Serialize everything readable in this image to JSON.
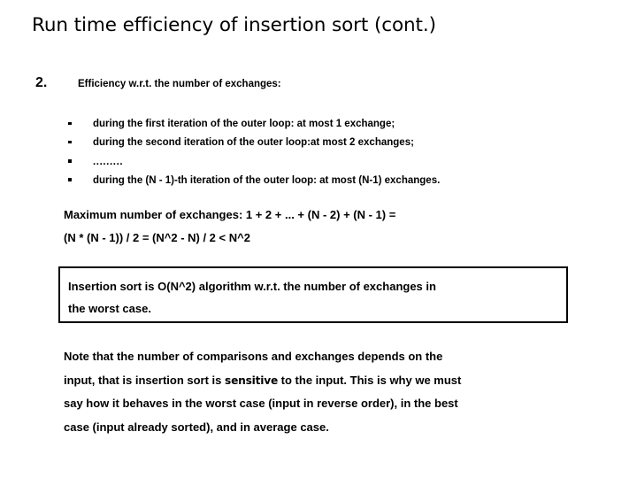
{
  "slide": {
    "title": "Run time efficiency of insertion sort (cont.)",
    "numbered_item": {
      "marker": "2.",
      "text": "Efficiency  w.r.t. the number of exchanges:"
    },
    "bullets": [
      {
        "marker": "square-bullet",
        "text": "during the first iteration of the outer loop: at most 1 exchange;"
      },
      {
        "marker": "square-bullet",
        "text": "during the second iteration of the outer loop:at most 2 exchanges;"
      },
      {
        "marker": "square-bullet",
        "text": "........."
      },
      {
        "marker": "square-bullet",
        "text": "during the (N - 1)-th iteration of the outer loop: at most (N-1) exchanges."
      }
    ],
    "formula": {
      "line1": "Maximum number of exchanges: 1 + 2 + ... + (N - 2) + (N - 1) =",
      "line2": "(N * (N - 1)) / 2 = (N^2 - N) / 2 < N^2"
    },
    "callout": {
      "line1": "Insertion sort is O(N^2) algorithm w.r.t. the number of  exchanges in",
      "line2": "the worst case.",
      "border_color": "#000000"
    },
    "note": {
      "line1": "Note that the number of comparisons and exchanges depends on the",
      "line2_part1": "input, that is insertion sort is ",
      "line2_emphasis": "sensitive",
      "line2_part2": " to the input. This is why we must",
      "line3": "say how it behaves in the worst case (input in reverse order), in the best",
      "line4": "case (input already sorted), and in average case."
    }
  }
}
